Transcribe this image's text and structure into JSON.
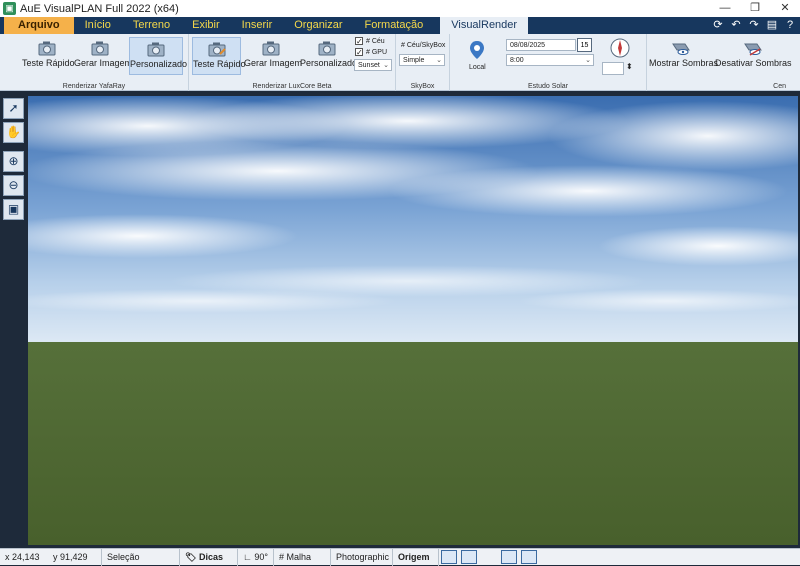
{
  "window": {
    "title": "AuE VisualPLAN Full 2022 (x64)",
    "icon": "app-logo-icon",
    "controls": [
      "minimize-icon",
      "restore-icon",
      "close-icon"
    ]
  },
  "tabs": {
    "file": "Arquivo",
    "items": [
      "Início",
      "Terreno",
      "Exibir",
      "Inserir",
      "Organizar",
      "Formatação"
    ],
    "active": "VisualRender"
  },
  "quick_access": [
    "refresh-icon",
    "undo-icon",
    "redo-icon",
    "save-icon",
    "help-icon"
  ],
  "ribbon": {
    "yafaray": {
      "label": "Renderizar YafaRay",
      "buttons": [
        "Teste Rápido",
        "Gerar Imagem",
        "Personalizado"
      ]
    },
    "luxcore": {
      "label": "Renderizar LuxCore Beta",
      "buttons": [
        "Teste Rápido",
        "Gerar Imagem",
        "Personalizado"
      ],
      "checks": [
        "# Céu",
        "# GPU"
      ],
      "preset": "Sunset"
    },
    "skybox": {
      "label": "SkyBox",
      "title": "# Céu/SkyBox",
      "value": "Simple"
    },
    "solar": {
      "label": "Estudo Solar",
      "local": "Local",
      "date": "08/08/2025",
      "time": "8:00",
      "calendar_day": "15"
    },
    "scene": {
      "label": "Cen",
      "show_shadows": "Mostrar Sombras",
      "hide_shadows": "Desativar Sombras"
    }
  },
  "status": {
    "x": "x 24,143",
    "y": "y 91,429",
    "mode": "Seleção",
    "tips": "Dicas",
    "angle": "90°",
    "grid": "Malha",
    "render_style": "Photographic",
    "origin": "Origem"
  },
  "colors": {
    "title_bg": "#ffffff",
    "tab_bg": "#17375e",
    "tab_text": "#f6d94a",
    "file_tab": "#f5b14a",
    "ribbon_bg": "#e8eef5",
    "sky_top": "#3f74b8",
    "sky_bottom": "#c9dcef",
    "ground": "#4e6530"
  }
}
